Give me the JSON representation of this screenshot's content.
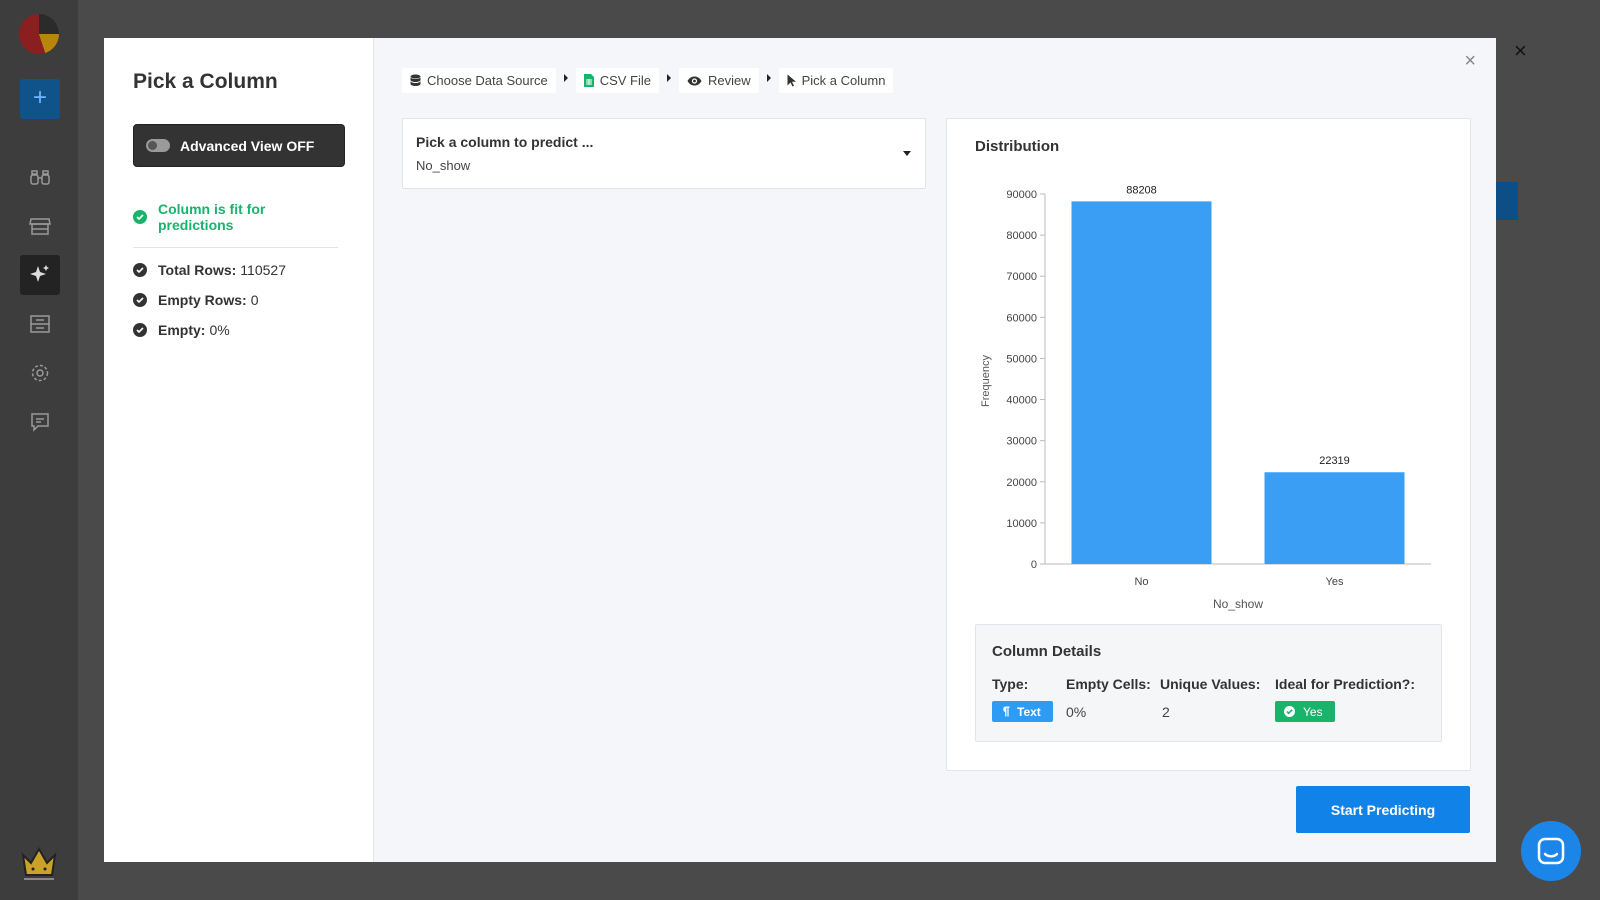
{
  "modal": {
    "title": "Pick a Column",
    "advanced_view_label": "Advanced View OFF",
    "fit_message": "Column is fit for predictions",
    "stats": [
      {
        "label": "Total Rows:",
        "value": "110527"
      },
      {
        "label": "Empty Rows:",
        "value": "0"
      },
      {
        "label": "Empty:",
        "value": "0%"
      }
    ],
    "breadcrumbs": [
      "Choose Data Source",
      "CSV File",
      "Review",
      "Pick a Column"
    ],
    "close": "×",
    "picker": {
      "label": "Pick a column to predict ...",
      "value": "No_show"
    },
    "distribution_title": "Distribution",
    "column_details": {
      "title": "Column Details",
      "type_label": "Type:",
      "type_value": "Text",
      "empty_label": "Empty Cells:",
      "empty_value": "0%",
      "unique_label": "Unique Values:",
      "unique_value": "2",
      "ideal_label": "Ideal for Prediction?:",
      "ideal_value": "Yes"
    },
    "start_button": "Start Predicting"
  },
  "background": {
    "close": "×",
    "add": "+"
  },
  "colors": {
    "accent": "#1182e8",
    "bar": "#3a9ef5",
    "success": "#19b36b"
  },
  "chart_data": {
    "type": "bar",
    "categories": [
      "No",
      "Yes"
    ],
    "values": [
      88208,
      22319
    ],
    "data_labels": [
      "88208",
      "22319"
    ],
    "title": "Distribution",
    "xlabel": "No_show",
    "ylabel": "Frequency",
    "ylim": [
      0,
      90000
    ],
    "yticks": [
      0,
      10000,
      20000,
      30000,
      40000,
      50000,
      60000,
      70000,
      80000,
      90000
    ],
    "grid": false
  }
}
